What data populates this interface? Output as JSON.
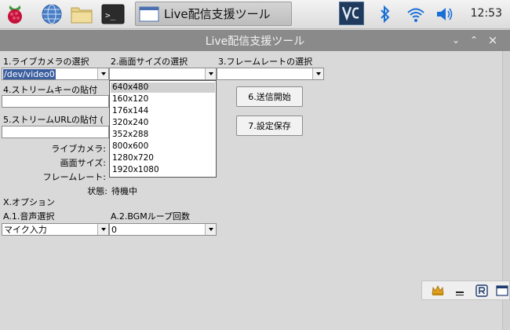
{
  "taskbar": {
    "task_title": "Live配信支援ツール",
    "clock": "12:53",
    "terminal_glyph": ">_"
  },
  "window": {
    "title": "Live配信支援ツール",
    "controls": [
      "⌄",
      "⌃",
      "×"
    ]
  },
  "form": {
    "camera_label": "1.ライブカメラの選択",
    "camera_value": "/dev/video0",
    "size_label": "2.画面サイズの選択",
    "size_value": "",
    "framerate_label": "3.フレームレートの選択",
    "framerate_value": "",
    "streamkey_label": "4.ストリームキーの貼付",
    "streamurl_label": "5.ストリームURLの貼付 (",
    "start_button": "6.送信開始",
    "save_button": "7.設定保存",
    "info_camera": "ライブカメラ:",
    "info_size": "画面サイズ:",
    "info_framerate": "フレームレート:",
    "status_label": "状態:",
    "status_value": "待機中",
    "options_label": "X.オプション",
    "audio_label": "A.1.音声選択",
    "audio_value": "マイク入力",
    "bgm_label": "A.2.BGMループ回数",
    "bgm_value": "0"
  },
  "size_dropdown": {
    "items": [
      "640x480",
      "160x120",
      "176x144",
      "320x240",
      "352x288",
      "800x600",
      "1280x720",
      "1920x1080"
    ],
    "highlighted": "640x480"
  },
  "colors": {
    "titlebar": "#8a8a8a",
    "selection": "#3c5f9f",
    "vnc_bg": "#1f3a5c",
    "bluetooth": "#1a6fd6"
  }
}
